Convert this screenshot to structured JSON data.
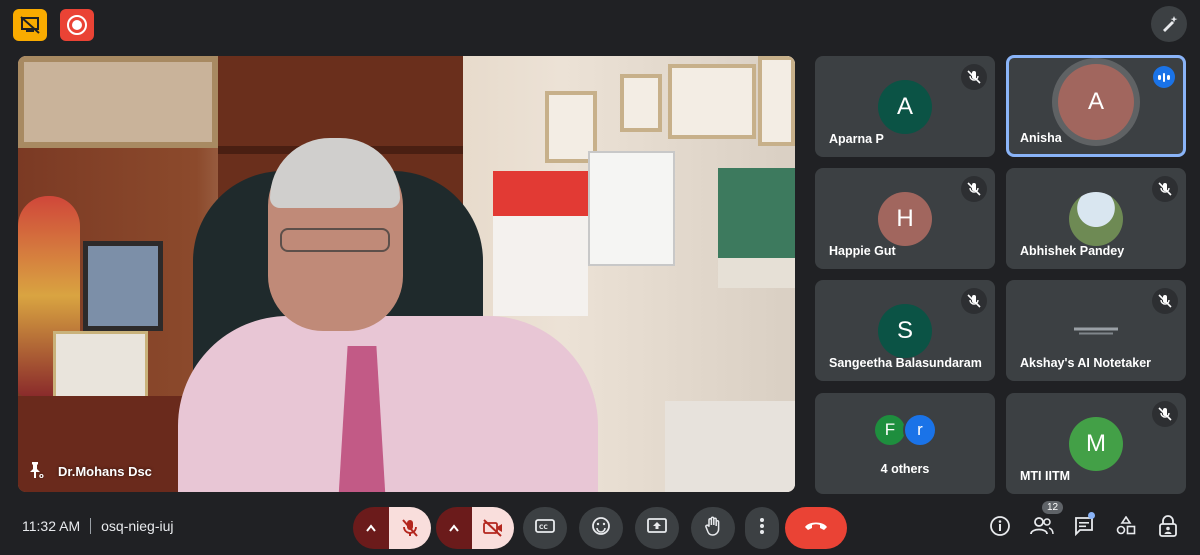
{
  "meeting": {
    "time": "11:32 AM",
    "code": "osq-nieg-iuj"
  },
  "main_speaker": {
    "name": "Dr.Mohans Dsc"
  },
  "participants": [
    {
      "name": "Aparna P",
      "initial": "A",
      "color": "#0b5345",
      "muted": true
    },
    {
      "name": "Anisha",
      "initial": "A",
      "color": "#a1665e",
      "speaking": true
    },
    {
      "name": "Happie Gut",
      "initial": "H",
      "color": "#a1665e",
      "muted": true
    },
    {
      "name": "Abhishek Pandey",
      "initial": "",
      "color": "photo",
      "muted": true
    },
    {
      "name": "Sangeetha Balasundaram",
      "initial": "S",
      "color": "#0b5345",
      "muted": true
    },
    {
      "name": "Akshay's AI Notetaker",
      "initial": "",
      "color": "logo",
      "muted": true
    },
    {
      "name": "MTI IITM",
      "initial": "M",
      "color": "#43a047",
      "muted": true
    }
  ],
  "others_tile": {
    "label": "4 others",
    "avatars": [
      {
        "initial": "F",
        "color": "#1e8e3e"
      },
      {
        "initial": "r",
        "color": "#1a73e8"
      }
    ]
  },
  "people_count": "12",
  "icons": {
    "top_left_1": "present-off-icon",
    "top_left_2": "recording-icon",
    "top_right": "pen-sparkle-icon",
    "mic": "mic-off-icon",
    "camera": "camera-off-icon",
    "captions": "captions-icon",
    "reactions": "emoji-icon",
    "present": "present-screen-icon",
    "raise_hand": "hand-icon",
    "more": "more-vert-icon",
    "end_call": "end-call-icon",
    "info": "info-icon",
    "people": "people-icon",
    "chat": "chat-icon",
    "activities": "activities-icon",
    "host_controls": "lock-person-icon"
  },
  "colors": {
    "background": "#202124",
    "tile": "#3c4043",
    "end_call": "#ea4335",
    "mic_off_bg": "#f9dedc",
    "active_border": "#8ab4f8"
  }
}
